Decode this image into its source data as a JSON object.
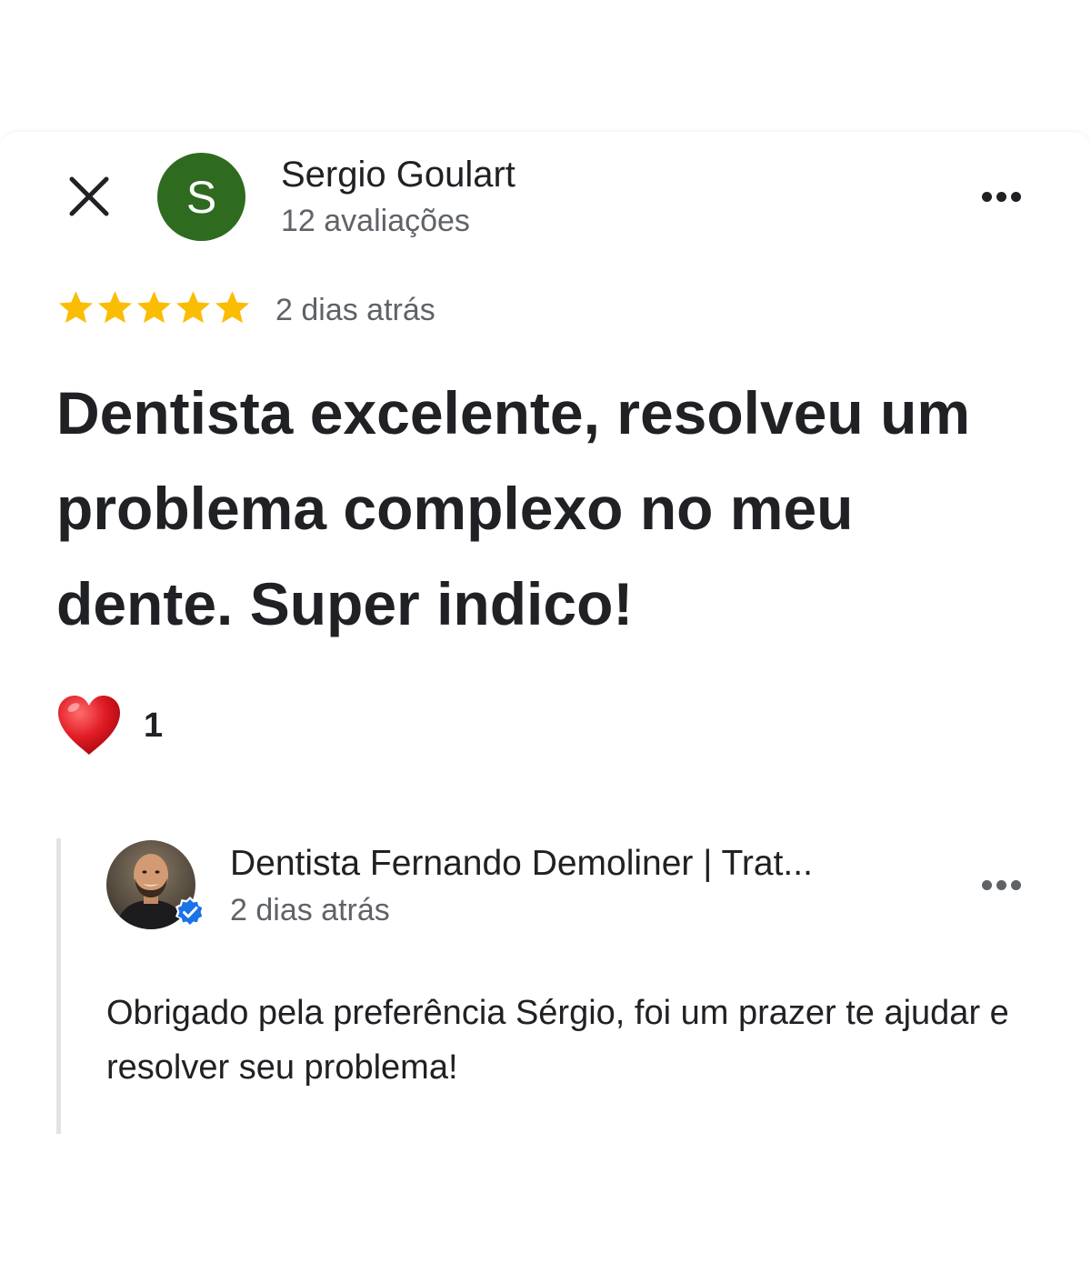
{
  "review": {
    "reviewer": {
      "initial": "S",
      "name": "Sergio Goulart",
      "reviews_count": "12 avaliações",
      "avatar_color": "#2e6b1f"
    },
    "rating": 5,
    "max_rating": 5,
    "star_color": "#fbbc04",
    "date": "2 dias atrás",
    "text": "Dentista excelente, resolveu um problema complexo no meu dente. Super indico!",
    "reaction": {
      "icon": "heart-icon",
      "count": "1"
    }
  },
  "owner_reply": {
    "name": "Dentista Fernando Demoliner | Trat...",
    "date": "2 dias atrás",
    "verified": true,
    "verified_color": "#1a73e8",
    "text": "Obrigado pela preferência Sérgio, foi um prazer te ajudar e resolver seu problema!"
  },
  "icons": {
    "close": "close-icon",
    "more": "more-horizontal-icon"
  }
}
